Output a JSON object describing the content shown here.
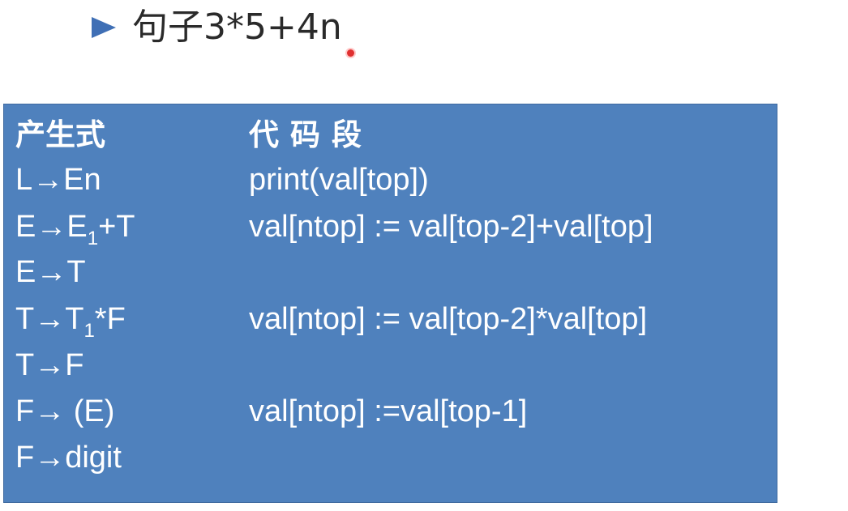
{
  "bullet": {
    "text": "句子3*5+4n"
  },
  "table": {
    "header": {
      "production": "产生式",
      "code": "代码段"
    },
    "rows": [
      {
        "lhs": "L",
        "arrow": "→",
        "rhs": "En",
        "sub": "",
        "rhs_after": "",
        "code": "print(val[top])"
      },
      {
        "lhs": "E",
        "arrow": "→",
        "rhs": "E",
        "sub": "1",
        "rhs_after": "+T",
        "code": "val[ntop] := val[top-2]+val[top]"
      },
      {
        "lhs": "E",
        "arrow": "→",
        "rhs": "T",
        "sub": "",
        "rhs_after": "",
        "code": ""
      },
      {
        "lhs": "T",
        "arrow": "→",
        "rhs": "T",
        "sub": "1",
        "rhs_after": "*F",
        "code": "val[ntop] := val[top-2]*val[top]"
      },
      {
        "lhs": "T",
        "arrow": "→",
        "rhs": "F",
        "sub": "",
        "rhs_after": "",
        "code": ""
      },
      {
        "lhs": "F",
        "arrow": "→",
        "rhs": " (E)",
        "sub": "",
        "rhs_after": "",
        "code": "val[ntop] :=val[top-1]"
      },
      {
        "lhs": "F",
        "arrow": "→",
        "rhs": "digit",
        "sub": "",
        "rhs_after": "",
        "code": ""
      }
    ]
  },
  "colors": {
    "table_bg": "#4f81bd",
    "bullet_arrow": "#3f6fb5",
    "cursor": "#e03030"
  }
}
